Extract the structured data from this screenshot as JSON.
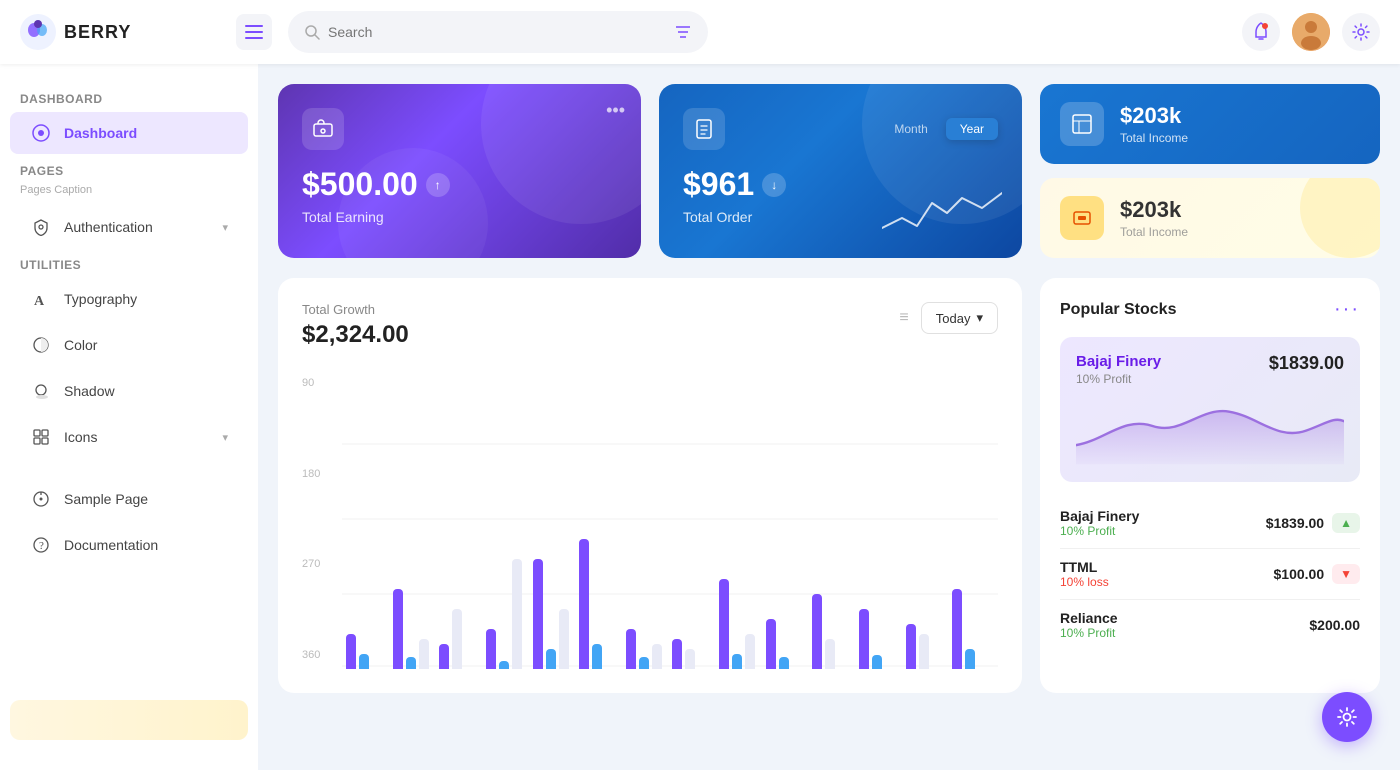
{
  "app": {
    "name": "BERRY"
  },
  "topbar": {
    "search_placeholder": "Search",
    "bell_label": "Notifications",
    "settings_label": "Settings"
  },
  "sidebar": {
    "sections": [
      {
        "title": "Dashboard",
        "items": [
          {
            "id": "dashboard",
            "label": "Dashboard",
            "active": true,
            "has_chevron": false
          }
        ]
      },
      {
        "title": "Pages",
        "caption": "Pages Caption",
        "items": [
          {
            "id": "authentication",
            "label": "Authentication",
            "active": false,
            "has_chevron": true
          }
        ]
      },
      {
        "title": "Utilities",
        "items": [
          {
            "id": "typography",
            "label": "Typography",
            "active": false,
            "has_chevron": false
          },
          {
            "id": "color",
            "label": "Color",
            "active": false,
            "has_chevron": false
          },
          {
            "id": "shadow",
            "label": "Shadow",
            "active": false,
            "has_chevron": false
          },
          {
            "id": "icons",
            "label": "Icons",
            "active": false,
            "has_chevron": true
          }
        ]
      },
      {
        "title": "",
        "items": [
          {
            "id": "sample-page",
            "label": "Sample Page",
            "active": false,
            "has_chevron": false
          },
          {
            "id": "documentation",
            "label": "Documentation",
            "active": false,
            "has_chevron": false
          }
        ]
      }
    ]
  },
  "cards": {
    "earning": {
      "amount": "$500.00",
      "label": "Total Earning"
    },
    "order": {
      "amount": "$961",
      "label": "Total Order",
      "toggle_month": "Month",
      "toggle_year": "Year"
    },
    "income_blue": {
      "amount": "$203k",
      "label": "Total Income"
    },
    "income_yellow": {
      "amount": "$203k",
      "label": "Total Income"
    }
  },
  "chart": {
    "title": "Total Growth",
    "amount": "$2,324.00",
    "filter_label": "Today",
    "y_labels": [
      "90",
      "180",
      "270",
      "360"
    ],
    "bars": [
      {
        "purple": 35,
        "blue": 15,
        "light": 10
      },
      {
        "purple": 80,
        "blue": 12,
        "light": 30
      },
      {
        "purple": 25,
        "blue": 10,
        "light": 60
      },
      {
        "purple": 40,
        "blue": 8,
        "light": 110
      },
      {
        "purple": 110,
        "blue": 20,
        "light": 60
      },
      {
        "purple": 130,
        "blue": 25,
        "light": 40
      },
      {
        "purple": 40,
        "blue": 12,
        "light": 25
      },
      {
        "purple": 30,
        "blue": 10,
        "light": 20
      },
      {
        "purple": 90,
        "blue": 15,
        "light": 35
      },
      {
        "purple": 50,
        "blue": 12,
        "light": 20
      },
      {
        "purple": 75,
        "blue": 18,
        "light": 30
      },
      {
        "purple": 60,
        "blue": 14,
        "light": 25
      },
      {
        "purple": 45,
        "blue": 10,
        "light": 35
      },
      {
        "purple": 80,
        "blue": 20,
        "light": 28
      }
    ]
  },
  "stocks": {
    "title": "Popular Stocks",
    "featured": {
      "name": "Bajaj Finery",
      "profit_label": "10% Profit",
      "price": "$1839.00"
    },
    "list": [
      {
        "name": "Bajaj Finery",
        "change": "10% Profit",
        "change_type": "profit",
        "price": "$1839.00"
      },
      {
        "name": "TTML",
        "change": "10% loss",
        "change_type": "loss",
        "price": "$100.00"
      },
      {
        "name": "Reliance",
        "change": "10% Profit",
        "change_type": "profit",
        "price": "$200.00"
      }
    ]
  }
}
